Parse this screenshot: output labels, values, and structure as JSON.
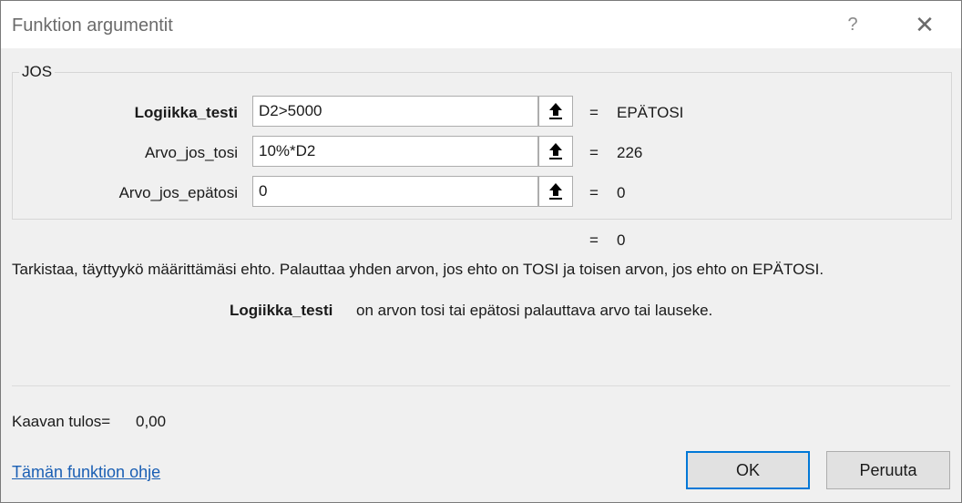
{
  "window": {
    "title": "Funktion argumentit",
    "help_glyph": "?",
    "close_glyph": "✕"
  },
  "function_group": {
    "name": "JOS",
    "args": [
      {
        "label": "Logiikka_testi",
        "value": "D2>5000",
        "result": "EPÄTOSI"
      },
      {
        "label": "Arvo_jos_tosi",
        "value": "10%*D2",
        "result": "226"
      },
      {
        "label": "Arvo_jos_epätosi",
        "value": "0",
        "result": "0"
      }
    ],
    "eq_sign": "="
  },
  "overall_result": "0",
  "description": "Tarkistaa, täyttyykö määrittämäsi ehto. Palauttaa yhden arvon, jos ehto on TOSI ja toisen arvon, jos ehto on EPÄTOSI.",
  "arg_description": {
    "name": "Logiikka_testi",
    "text": "on arvon tosi tai epätosi palauttava arvo tai lauseke."
  },
  "formula_result": {
    "label": "Kaavan tulos=",
    "value": "0,00"
  },
  "help_link": "Tämän funktion ohje",
  "buttons": {
    "ok": "OK",
    "cancel": "Peruuta"
  },
  "icons": {
    "ref_button": "collapse-dialog-arrow-icon"
  }
}
